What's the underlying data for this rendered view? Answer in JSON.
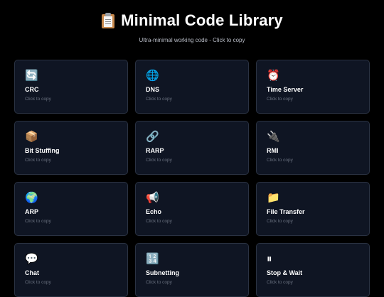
{
  "header": {
    "title": "Minimal Code Library",
    "subtitle": "Ultra-minimal working code - Click to copy"
  },
  "cards": [
    {
      "icon": "🔄",
      "icon_name": "refresh-icon",
      "title": "CRC",
      "hint": "Click to copy"
    },
    {
      "icon": "🌐",
      "icon_name": "globe-icon",
      "title": "DNS",
      "hint": "Click to copy"
    },
    {
      "icon": "⏰",
      "icon_name": "alarm-clock-icon",
      "title": "Time Server",
      "hint": "Click to copy"
    },
    {
      "icon": "📦",
      "icon_name": "package-icon",
      "title": "Bit Stuffing",
      "hint": "Click to copy"
    },
    {
      "icon": "🔗",
      "icon_name": "link-icon",
      "title": "RARP",
      "hint": "Click to copy"
    },
    {
      "icon": "🔌",
      "icon_name": "plug-icon",
      "title": "RMI",
      "hint": "Click to copy"
    },
    {
      "icon": "🌍",
      "icon_name": "earth-icon",
      "title": "ARP",
      "hint": "Click to copy"
    },
    {
      "icon": "📢",
      "icon_name": "megaphone-icon",
      "title": "Echo",
      "hint": "Click to copy"
    },
    {
      "icon": "📁",
      "icon_name": "folder-icon",
      "title": "File Transfer",
      "hint": "Click to copy"
    },
    {
      "icon": "💬",
      "icon_name": "speech-bubble-icon",
      "title": "Chat",
      "hint": "Click to copy"
    },
    {
      "icon": "🔢",
      "icon_name": "numbers-icon",
      "title": "Subnetting",
      "hint": "Click to copy"
    },
    {
      "icon": "⏸",
      "icon_name": "pause-icon",
      "title": "Stop & Wait",
      "hint": "Click to copy"
    }
  ]
}
